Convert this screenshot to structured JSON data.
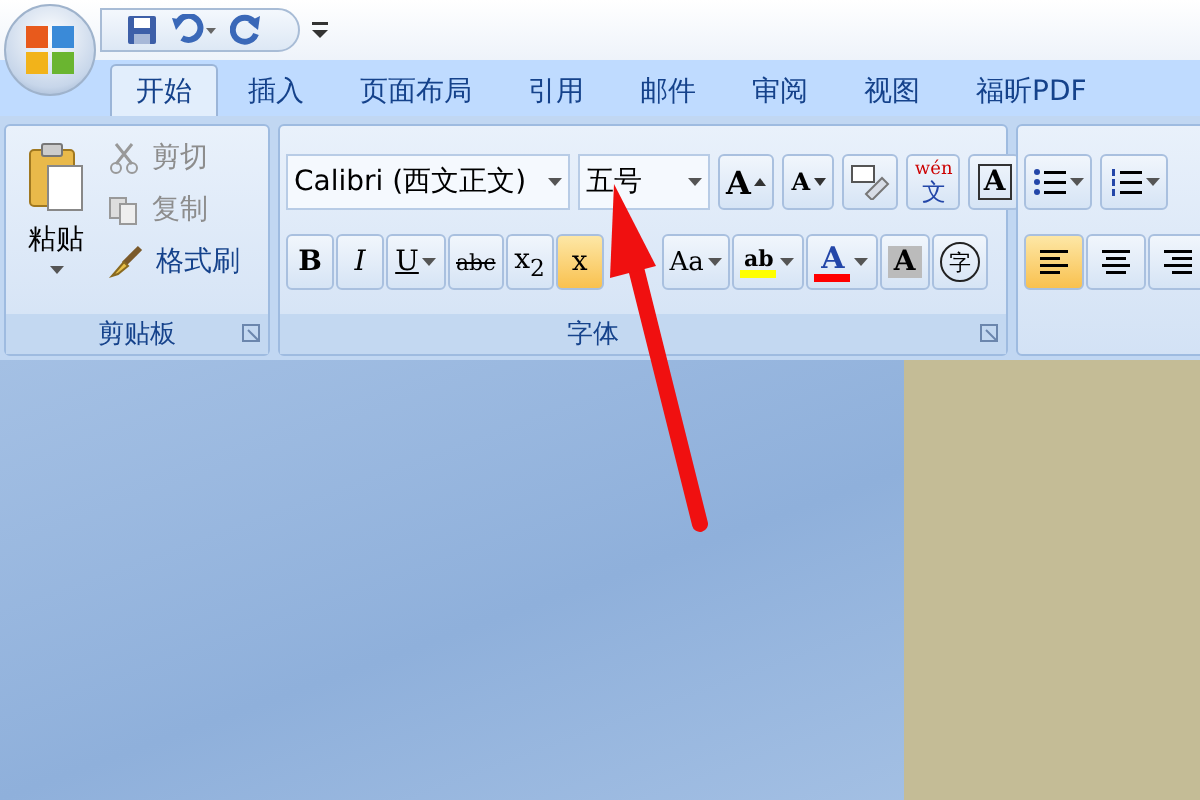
{
  "quick_access": {
    "buttons": [
      {
        "kind": "save"
      },
      {
        "kind": "undo"
      },
      {
        "kind": "redo"
      }
    ]
  },
  "tabs": [
    {
      "label": "开始",
      "selected": true
    },
    {
      "label": "插入",
      "selected": false
    },
    {
      "label": "页面布局",
      "selected": false
    },
    {
      "label": "引用",
      "selected": false
    },
    {
      "label": "邮件",
      "selected": false
    },
    {
      "label": "审阅",
      "selected": false
    },
    {
      "label": "视图",
      "selected": false
    },
    {
      "label": "福昕PDF",
      "selected": false
    }
  ],
  "clipboard": {
    "label": "剪贴板",
    "paste": "粘贴",
    "items": [
      {
        "label": "剪切",
        "kind": "cut",
        "disabled": true
      },
      {
        "label": "复制",
        "kind": "copy",
        "disabled": true
      },
      {
        "label": "格式刷",
        "kind": "painter",
        "disabled": false
      }
    ]
  },
  "font": {
    "label": "字体",
    "font_name": "Calibri (西文正文)",
    "font_size": "五号",
    "row1": [
      {
        "kind": "grow",
        "glyph": "A"
      },
      {
        "kind": "shrink",
        "glyph": "A"
      },
      {
        "kind": "clear"
      },
      {
        "kind": "phonetic",
        "glyph": "wén",
        "sub": "文"
      },
      {
        "kind": "boxed",
        "glyph": "A"
      }
    ],
    "row2": [
      {
        "kind": "bold",
        "glyph": "B"
      },
      {
        "kind": "italic",
        "glyph": "I"
      },
      {
        "kind": "underline",
        "glyph": "U"
      },
      {
        "kind": "strike",
        "glyph": "abc"
      },
      {
        "kind": "script",
        "glyph": "x$_{2}$",
        "selected": false
      },
      {
        "kind": "script",
        "glyph": "x",
        "selected": true
      },
      {
        "kind": "case",
        "glyph": "Aa"
      },
      {
        "kind": "highlight",
        "glyph": "ab",
        "color": "#ffff00"
      },
      {
        "kind": "fontcolor",
        "glyph": "A",
        "color": "#ff0000"
      },
      {
        "kind": "shade",
        "glyph": "A"
      },
      {
        "kind": "enclose",
        "glyph": "字"
      }
    ]
  },
  "paragraph": {
    "lists": [
      {
        "kind": "bullets"
      },
      {
        "kind": "numbering"
      }
    ],
    "align": [
      {
        "kind": "left",
        "selected": true
      },
      {
        "kind": "center",
        "selected": false
      },
      {
        "kind": "right",
        "selected": false
      }
    ]
  }
}
